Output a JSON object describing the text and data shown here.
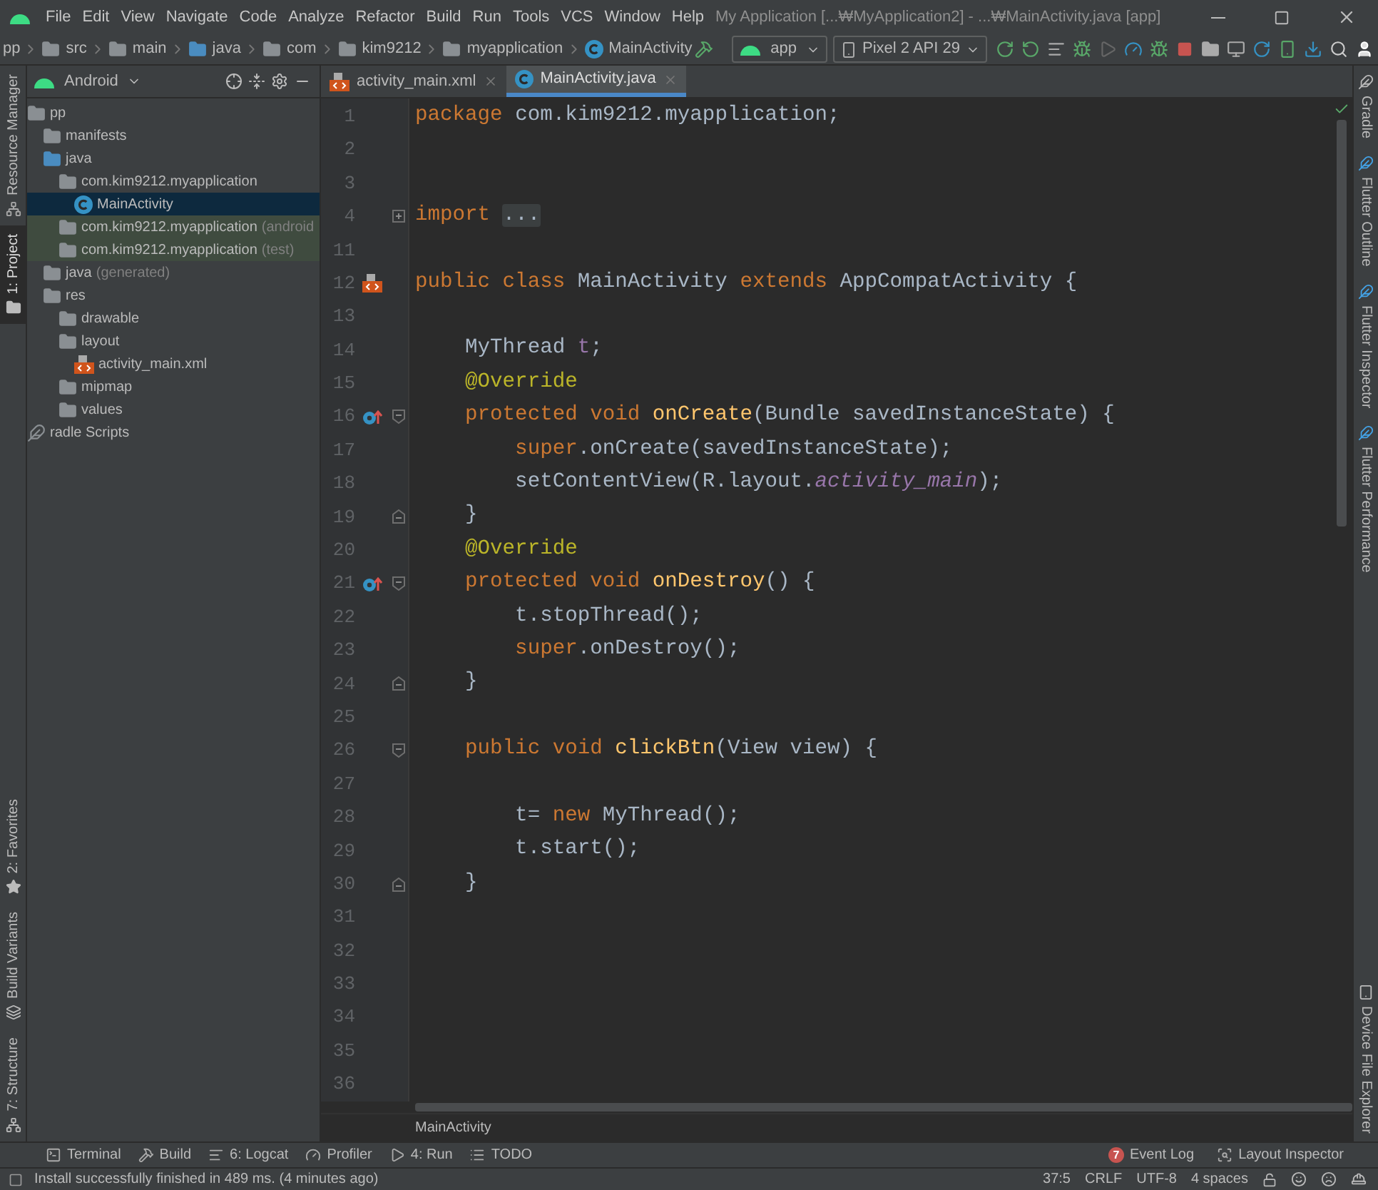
{
  "window": {
    "title": "My Application [...₩MyApplication2] - ...₩MainActivity.java [app]"
  },
  "menu": [
    "File",
    "Edit",
    "View",
    "Navigate",
    "Code",
    "Analyze",
    "Refactor",
    "Build",
    "Run",
    "Tools",
    "VCS",
    "Window",
    "Help"
  ],
  "breadcrumbs": [
    {
      "label": "pp",
      "kind": "module"
    },
    {
      "label": "src",
      "kind": "folder"
    },
    {
      "label": "main",
      "kind": "folder"
    },
    {
      "label": "java",
      "kind": "source"
    },
    {
      "label": "com",
      "kind": "package"
    },
    {
      "label": "kim9212",
      "kind": "package"
    },
    {
      "label": "myapplication",
      "kind": "package"
    },
    {
      "label": "MainActivity",
      "kind": "class"
    }
  ],
  "toolbar": {
    "run_config": "app",
    "device": "Pixel 2 API 29"
  },
  "project_view": {
    "mode": "Android"
  },
  "tree": [
    {
      "label": "pp",
      "kind": "module",
      "selected": false,
      "children": [
        {
          "label": "manifests",
          "kind": "folder",
          "selected": false
        },
        {
          "label": "java",
          "kind": "source",
          "selected": false,
          "children": [
            {
              "label": "com.kim9212.myapplication",
              "kind": "package",
              "selected": false,
              "children": [
                {
                  "label": "MainActivity",
                  "kind": "class",
                  "selected": true
                }
              ]
            },
            {
              "label": "com.kim9212.myapplication",
              "note": "(android",
              "kind": "test-package",
              "selected": false
            },
            {
              "label": "com.kim9212.myapplication",
              "note": "(test)",
              "kind": "test-package",
              "selected": false
            }
          ]
        },
        {
          "label": "java",
          "note": "(generated)",
          "kind": "generated",
          "selected": false
        },
        {
          "label": "res",
          "kind": "resources",
          "selected": false,
          "children": [
            {
              "label": "drawable",
              "kind": "package",
              "selected": false
            },
            {
              "label": "layout",
              "kind": "package",
              "selected": false,
              "children": [
                {
                  "label": "activity_main.xml",
                  "kind": "layout",
                  "selected": false
                }
              ]
            },
            {
              "label": "mipmap",
              "kind": "package",
              "selected": false
            },
            {
              "label": "values",
              "kind": "package",
              "selected": false
            }
          ]
        }
      ]
    },
    {
      "label": "radle Scripts",
      "kind": "scripts",
      "selected": false
    }
  ],
  "tabs": [
    {
      "label": "activity_main.xml",
      "kind": "layout",
      "selected": false
    },
    {
      "label": "MainActivity.java",
      "kind": "class",
      "selected": true
    }
  ],
  "editor": {
    "lines": [
      {
        "number": "1",
        "tokens": [
          {
            "kind": "keyword",
            "text": "package"
          },
          {
            "kind": "plain",
            "text": " com.kim9212.myapplication;"
          }
        ]
      },
      {
        "number": "2"
      },
      {
        "number": "3"
      },
      {
        "number": "4",
        "folded": true,
        "tokens": [
          {
            "kind": "keyword",
            "text": "import "
          },
          {
            "kind": "folded",
            "text": "..."
          }
        ]
      },
      {
        "number": "11"
      },
      {
        "number": "12",
        "layout_marker": true,
        "tokens": [
          {
            "kind": "keyword",
            "text": "public class"
          },
          {
            "kind": "plain",
            "text": " MainActivity "
          },
          {
            "kind": "keyword",
            "text": "extends"
          },
          {
            "kind": "plain",
            "text": " AppCompatActivity {"
          }
        ]
      },
      {
        "number": "13"
      },
      {
        "number": "14",
        "tokens": [
          {
            "kind": "plain",
            "text": "    MyThread "
          },
          {
            "kind": "field",
            "text": "t"
          },
          {
            "kind": "plain",
            "text": ";"
          }
        ]
      },
      {
        "number": "15",
        "tokens": [
          {
            "kind": "annotation",
            "text": "    @Override"
          }
        ]
      },
      {
        "number": "16",
        "override": true,
        "fold_start": true,
        "tokens": [
          {
            "kind": "keyword",
            "text": "    protected void "
          },
          {
            "kind": "method",
            "text": "onCreate"
          },
          {
            "kind": "plain",
            "text": "(Bundle savedInstanceState) {"
          }
        ]
      },
      {
        "number": "17",
        "tokens": [
          {
            "kind": "keyword",
            "text": "        super"
          },
          {
            "kind": "plain",
            "text": ".onCreate(savedInstanceState);"
          }
        ]
      },
      {
        "number": "18",
        "tokens": [
          {
            "kind": "plain",
            "text": "        setContentView(R.layout."
          },
          {
            "kind": "static",
            "text": "activity_main"
          },
          {
            "kind": "plain",
            "text": ");"
          }
        ]
      },
      {
        "number": "19",
        "fold_end": true,
        "tokens": [
          {
            "kind": "plain",
            "text": "    }"
          }
        ]
      },
      {
        "number": "20",
        "tokens": [
          {
            "kind": "annotation",
            "text": "    @Override"
          }
        ]
      },
      {
        "number": "21",
        "override": true,
        "fold_start": true,
        "tokens": [
          {
            "kind": "keyword",
            "text": "    protected void "
          },
          {
            "kind": "method",
            "text": "onDestroy"
          },
          {
            "kind": "plain",
            "text": "() {"
          }
        ]
      },
      {
        "number": "22",
        "tokens": [
          {
            "kind": "plain",
            "text": "        t.stopThread();"
          }
        ]
      },
      {
        "number": "23",
        "tokens": [
          {
            "kind": "keyword",
            "text": "        super"
          },
          {
            "kind": "plain",
            "text": ".onDestroy();"
          }
        ]
      },
      {
        "number": "24",
        "fold_end": true,
        "tokens": [
          {
            "kind": "plain",
            "text": "    }"
          }
        ]
      },
      {
        "number": "25"
      },
      {
        "number": "26",
        "fold_start": true,
        "tokens": [
          {
            "kind": "keyword",
            "text": "    public void "
          },
          {
            "kind": "method",
            "text": "clickBtn"
          },
          {
            "kind": "plain",
            "text": "(View view) {"
          }
        ]
      },
      {
        "number": "27"
      },
      {
        "number": "28",
        "tokens": [
          {
            "kind": "plain",
            "text": "        t= "
          },
          {
            "kind": "keyword",
            "text": "new"
          },
          {
            "kind": "plain",
            "text": " MyThread();"
          }
        ]
      },
      {
        "number": "29",
        "tokens": [
          {
            "kind": "plain",
            "text": "        t.start();"
          }
        ]
      },
      {
        "number": "30",
        "fold_end": true,
        "tokens": [
          {
            "kind": "plain",
            "text": "    }"
          }
        ]
      },
      {
        "number": "31"
      },
      {
        "number": "32"
      },
      {
        "number": "33"
      },
      {
        "number": "34"
      },
      {
        "number": "35"
      },
      {
        "number": "36"
      }
    ],
    "breadcrumb": "MainActivity"
  },
  "left_strip_top": [
    {
      "label": "Resource Manager",
      "kind": "resources",
      "selected": false
    },
    {
      "label": "1: Project",
      "kind": "project",
      "selected": true
    }
  ],
  "left_strip_bottom": [
    {
      "label": "2: Favorites",
      "kind": "favorites",
      "selected": false
    },
    {
      "label": "Build Variants",
      "kind": "variants",
      "selected": false
    },
    {
      "label": "7: Structure",
      "kind": "structure",
      "selected": false
    }
  ],
  "right_strip_top": [
    {
      "label": "Gradle",
      "kind": "gradle"
    },
    {
      "label": "Flutter Outline",
      "kind": "flutter"
    },
    {
      "label": "Flutter Inspector",
      "kind": "flutter"
    },
    {
      "label": "Flutter Performance",
      "kind": "flutter"
    }
  ],
  "right_strip_bottom": [
    {
      "label": "Device File Explorer",
      "kind": "device"
    }
  ],
  "tool_tabs": [
    {
      "label": "Terminal",
      "kind": "terminal"
    },
    {
      "label": "Build",
      "kind": "build"
    },
    {
      "label": "6: Logcat",
      "kind": "logcat"
    },
    {
      "label": "Profiler",
      "kind": "profiler"
    },
    {
      "label": "4: Run",
      "kind": "run"
    },
    {
      "label": "TODO",
      "kind": "todo"
    }
  ],
  "tool_tabs_right": [
    {
      "label": "Event Log",
      "badge": "7"
    },
    {
      "label": "Layout Inspector",
      "kind": "inspector"
    }
  ],
  "status_bar": {
    "message": "Install successfully finished in 489 ms. (4 minutes ago)",
    "position": "37:5",
    "line_ending": "CRLF",
    "encoding": "UTF-8",
    "indent": "4 spaces"
  }
}
